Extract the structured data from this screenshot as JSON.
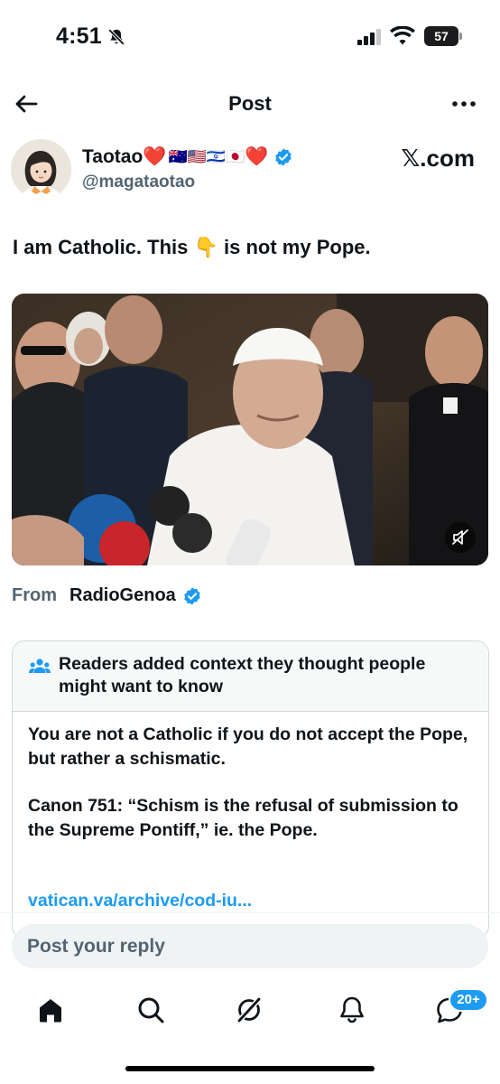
{
  "status_bar": {
    "time": "4:51",
    "battery": "57"
  },
  "header": {
    "title": "Post"
  },
  "author": {
    "name": "Taotao",
    "name_emoji_1": "❤️",
    "flags": "🇦🇺🇺🇸🇮🇱🇯🇵",
    "name_emoji_2": "❤️",
    "handle": "@magataotao",
    "watermark": "𝕏.com"
  },
  "post": {
    "text_before": "I am Catholic. This",
    "emoji": "👇",
    "text_after": "is not my Pope."
  },
  "video": {
    "source_label": "From",
    "source_name": "RadioGenoa"
  },
  "community_note": {
    "title": "Readers added context they thought people might want to know",
    "paragraph_1": "You are not a Catholic if you do not accept the Pope, but rather a schismatic.",
    "paragraph_2": "Canon 751: “Schism is the refusal of submission to the Supreme Pontiff,” ie. the Pope.",
    "link": "vatican.va/archive/cod-iu..."
  },
  "reply": {
    "placeholder": "Post your reply"
  },
  "bottom_nav": {
    "items": [
      "home-icon",
      "search-icon",
      "grok-icon",
      "notifications-icon",
      "messages-icon"
    ],
    "messages_badge": "20+"
  },
  "colors": {
    "accent": "#1d9bf0",
    "text": "#0f1419",
    "secondary": "#536471",
    "border": "#cfd9de"
  }
}
